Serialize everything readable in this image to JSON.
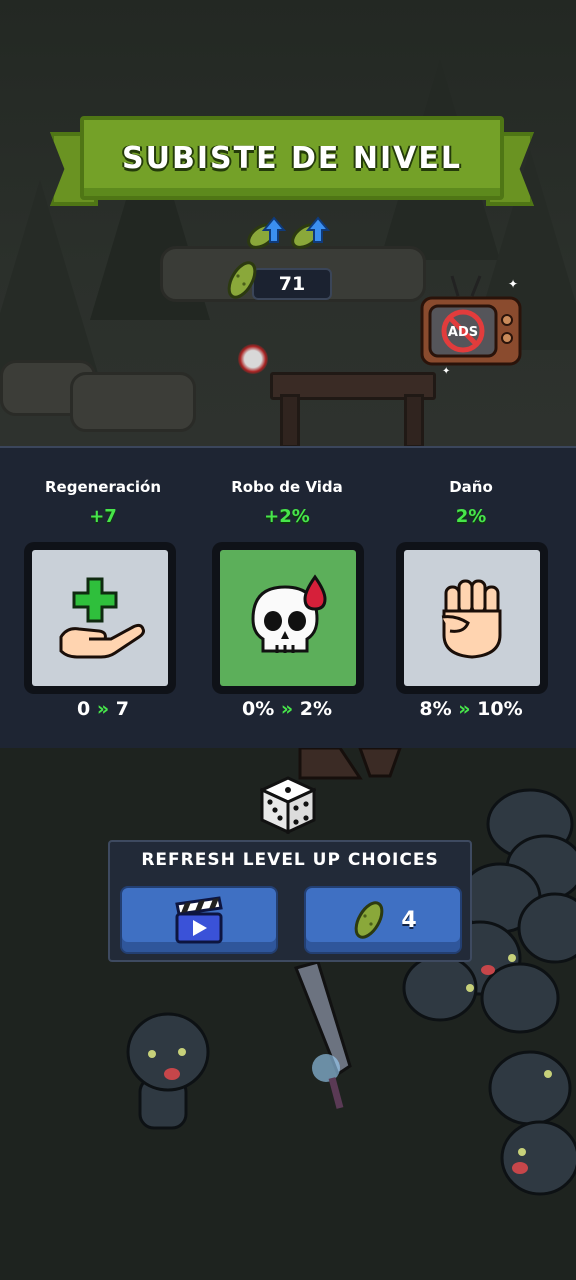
{
  "banner": {
    "title": "SUBISTE DE NIVEL"
  },
  "currency": {
    "pickles": "71",
    "icon": "pickle-icon"
  },
  "ad_icon": {
    "text": "ADS"
  },
  "choices": [
    {
      "name": "Regeneración",
      "delta": "+7",
      "from": "0",
      "to": "7",
      "icon": "hand-plus-icon",
      "bg": "#c9d0d8"
    },
    {
      "name": "Robo de Vida",
      "delta": "+2%",
      "from": "0%",
      "to": "2%",
      "icon": "skull-blood-icon",
      "bg": "#5caf5a"
    },
    {
      "name": "Daño",
      "delta": "2%",
      "from": "8%",
      "to": "10%",
      "icon": "fist-icon",
      "bg": "#c9d0d8"
    }
  ],
  "arrow_glyph": "»",
  "refresh": {
    "title": "REFRESH LEVEL UP CHOICES",
    "cost": "4"
  },
  "colors": {
    "accent_green": "#47e64a",
    "banner_green": "#74a128",
    "button_blue": "#3f70c3"
  }
}
